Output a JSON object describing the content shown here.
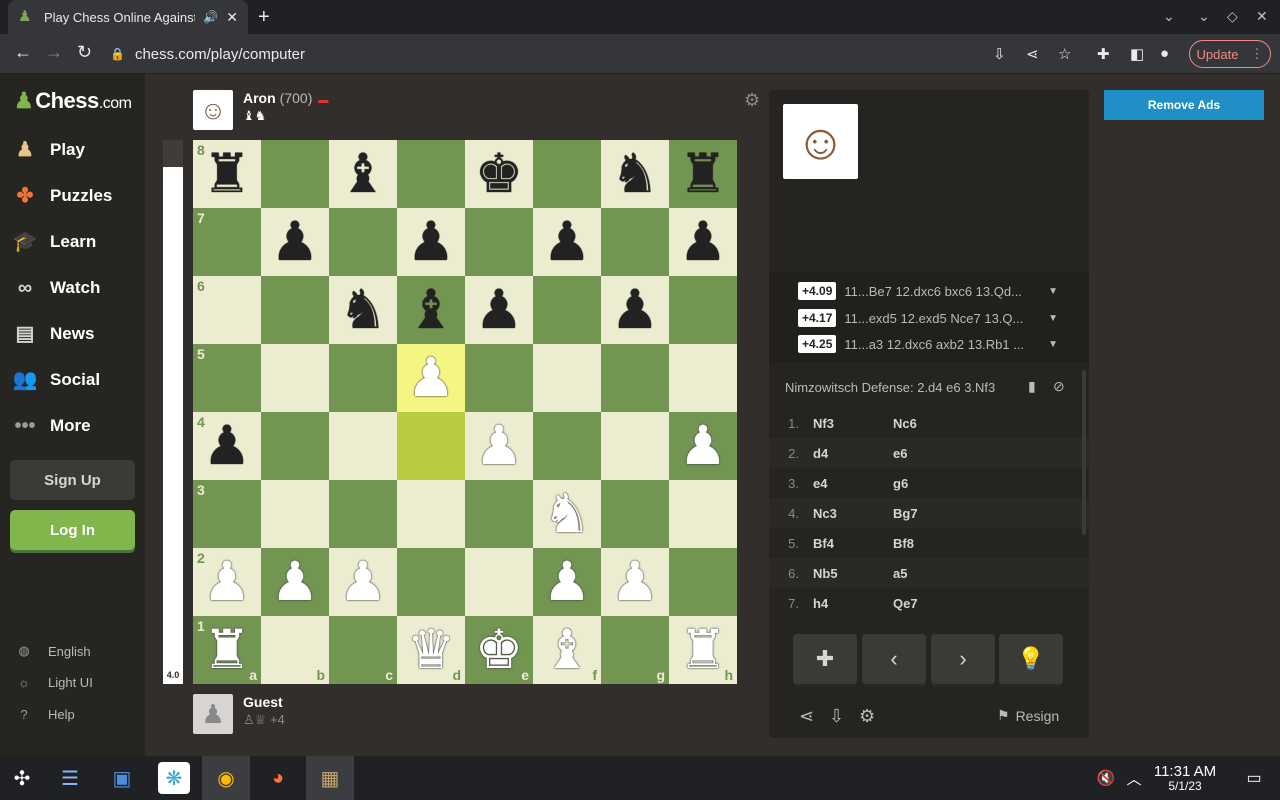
{
  "browser": {
    "tab_title": "Play Chess Online Against",
    "url": "chess.com/play/computer",
    "update_label": "Update"
  },
  "sidebar": {
    "logo": {
      "main": "Chess",
      "suffix": ".com"
    },
    "items": [
      {
        "label": "Play",
        "icon": "play-pawn-icon"
      },
      {
        "label": "Puzzles",
        "icon": "puzzle-icon"
      },
      {
        "label": "Learn",
        "icon": "graduation-cap-icon"
      },
      {
        "label": "Watch",
        "icon": "binoculars-icon"
      },
      {
        "label": "News",
        "icon": "newspaper-icon"
      },
      {
        "label": "Social",
        "icon": "people-icon"
      },
      {
        "label": "More",
        "icon": "more-dots-icon"
      }
    ],
    "signup": "Sign Up",
    "login": "Log In",
    "footer": [
      {
        "label": "English",
        "icon": "globe-icon"
      },
      {
        "label": "Light UI",
        "icon": "sun-icon"
      },
      {
        "label": "Help",
        "icon": "help-icon"
      }
    ]
  },
  "opponent": {
    "name": "Aron",
    "rating": "(700)",
    "captured": "♝♞"
  },
  "player": {
    "name": "Guest",
    "captured": "♙♕",
    "advantage": "+4"
  },
  "eval": {
    "value": "4.0"
  },
  "board": {
    "ranks": [
      "8",
      "7",
      "6",
      "5",
      "4",
      "3",
      "2",
      "1"
    ],
    "files": [
      "a",
      "b",
      "c",
      "d",
      "e",
      "f",
      "g",
      "h"
    ],
    "position": [
      [
        "r",
        "",
        "b",
        "",
        "k",
        "",
        "n",
        "r"
      ],
      [
        "",
        "p",
        "",
        "p",
        "",
        "p",
        "",
        "p"
      ],
      [
        "",
        "",
        "n",
        "b",
        "p",
        "",
        "p",
        ""
      ],
      [
        "",
        "",
        "",
        "P",
        "",
        "",
        "",
        ""
      ],
      [
        "p",
        "",
        "",
        "",
        "P",
        "",
        "",
        "P"
      ],
      [
        "",
        "",
        "",
        "",
        "",
        "N",
        "",
        ""
      ],
      [
        "P",
        "P",
        "P",
        "",
        "",
        "P",
        "P",
        ""
      ],
      [
        "R",
        "",
        "",
        "Q",
        "K",
        "B",
        "",
        "R"
      ]
    ],
    "highlight": [
      "d5",
      "d4"
    ]
  },
  "analysis": {
    "lines": [
      {
        "score": "+4.09",
        "moves": "11...Be7 12.dxc6 bxc6 13.Qd..."
      },
      {
        "score": "+4.17",
        "moves": "11...exd5 12.exd5 Nce7 13.Q..."
      },
      {
        "score": "+4.25",
        "moves": "11...a3 12.dxc6 axb2 13.Rb1 ..."
      }
    ],
    "opening": "Nimzowitsch Defense: 2.d4 e6 3.Nf3"
  },
  "moves": [
    {
      "n": "1.",
      "w": "Nf3",
      "b": "Nc6"
    },
    {
      "n": "2.",
      "w": "d4",
      "b": "e6"
    },
    {
      "n": "3.",
      "w": "e4",
      "b": "g6"
    },
    {
      "n": "4.",
      "w": "Nc3",
      "b": "Bg7"
    },
    {
      "n": "5.",
      "w": "Bf4",
      "b": "Bf8"
    },
    {
      "n": "6.",
      "w": "Nb5",
      "b": "a5"
    },
    {
      "n": "7.",
      "w": "h4",
      "b": "Qe7"
    }
  ],
  "controls": {
    "resign": "Resign"
  },
  "ads": {
    "remove": "Remove Ads"
  },
  "taskbar": {
    "time": "11:31 AM",
    "date": "5/1/23"
  }
}
